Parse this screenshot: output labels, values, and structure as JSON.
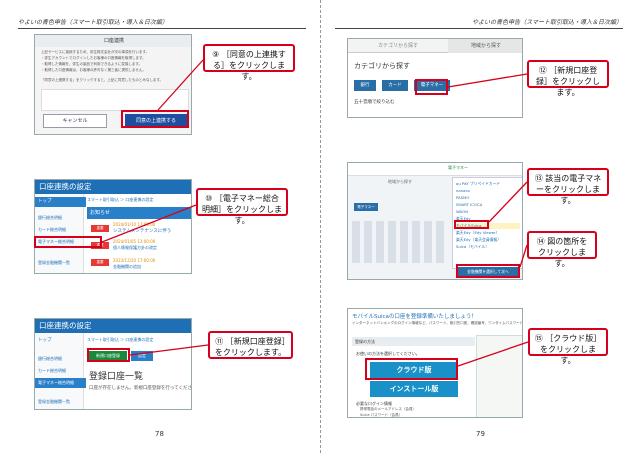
{
  "header": {
    "left": "やよいの青色申告（スマート取引取込・導入＆日次編）",
    "right": "やよいの青色申告（スマート取引取込・導入＆日次編）"
  },
  "page_numbers": {
    "left": "78",
    "right": "79"
  },
  "left_page": {
    "shot1": {
      "title": "口座連携",
      "lines": [
        "上記サービスに接続するため、弥生株式会社が次の事項を行います。",
        "・弥生アカウントでログインしたお客様の口座情報を取得します。",
        "・取得した情報を、弥生の製品で利用できるように変換します。",
        "・取得した口座情報は、お客様の許可なく第三者に提供しません。",
        "「同意の上連携する」をクリックすると、上記に同意したものとみなします。"
      ],
      "cancel_label": "キャンセル",
      "agree_label": "同意の上連携する"
    },
    "callout9": "⑨ ［同意の上連携する］をクリックします。",
    "shot2": {
      "title": "口座連携の設定",
      "nav": [
        "トップ",
        "銀行総合明細",
        "カード総合明細",
        "電子マネー総合明細",
        "登録金融機関一覧"
      ],
      "breadcrumb": "スマート取引取込 ＞ 口座連携の設定",
      "notice_title": "お知らせ",
      "badges": [
        "重要",
        "重要",
        "重要"
      ],
      "dates": [
        "2024/01/10 17:00:00",
        "2024/01/05 13:00:00",
        "2023/12/20 17:00:00"
      ],
      "notes": [
        "システムメンテナンスに伴う",
        "個人情報保護方針の改定",
        "金融機関の追加"
      ]
    },
    "callout10": "⑩ ［電子マネー総合明細］をクリックします。",
    "shot3": {
      "title": "口座連携の設定",
      "nav": [
        "トップ",
        "銀行総合明細",
        "カード総合明細",
        "電子マネー総合明細",
        "登録金融機関一覧"
      ],
      "breadcrumb": "スマート取引取込 ＞ 口座連携の設定",
      "new_button": "新規口座登録",
      "settings_button": "設定",
      "heading": "登録口座一覧",
      "empty_message": "口座が存在しません。新規口座登録を行ってください。"
    },
    "callout11": "⑪ ［新規口座登録］をクリックします。"
  },
  "right_page": {
    "shot1": {
      "tabs": [
        "カテゴリから探す",
        "地域から探す"
      ],
      "heading": "カテゴリから探す",
      "categories": [
        "銀行",
        "カード",
        "電子マネー"
      ],
      "filter_label": "五十音順で絞り込む"
    },
    "callout12": "⑫ ［新規口座登録］をクリックします。",
    "shot2": {
      "header_text": "電子マネー",
      "search_label": "地域から探す",
      "category_button": "電子マネー",
      "list": [
        "au PAY プリペイドカード",
        "nanaco",
        "PASMO",
        "SMART ICOCA",
        "WAON",
        "楽天Edy",
        "モバイルSuica",
        "楽天Edy（Edy Viewer）",
        "楽天Edy（楽天会員情報）",
        "Suica（モバイル）"
      ],
      "highlight_index": 6,
      "select_button": "金融機関を選択して次へ"
    },
    "callout13": "⑬ 該当の電子マネーをクリックします。",
    "callout14": "⑭ 図の箇所をクリックします。",
    "shot3": {
      "banner": "モバイルSuicaの口座を登録準備いたしましょう！",
      "sub": "インターネットバンキングのログイン情報など、パスワード、取引先口座、確認番号、ワンタイムパスワード",
      "section_label": "登録の方法",
      "choose_label": "お使いの方法を選択してください。",
      "cloud_button": "クラウド版",
      "install_button": "インストール版",
      "req_title": "必要なログイン情報",
      "req_lines": [
        "携帯電話のメールアドレス（会員）",
        "Suica パスワード（会員）"
      ]
    },
    "callout15": "⑮ ［クラウド版］をクリックします。"
  }
}
